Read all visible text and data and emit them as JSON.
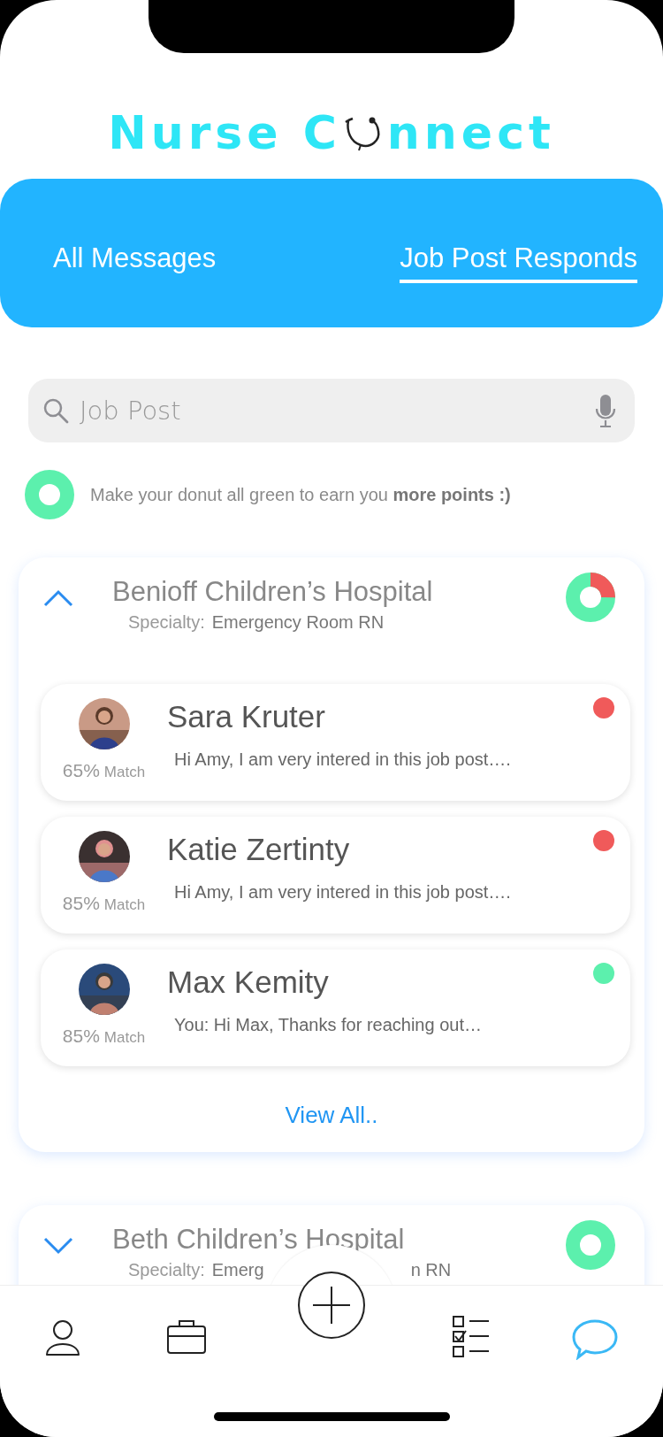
{
  "logo": {
    "text_start": "Nurse C",
    "text_end": "nnect"
  },
  "tabs": [
    {
      "label": "All Messages",
      "selected": false
    },
    {
      "label": "Job Post Responds",
      "selected": true
    }
  ],
  "search": {
    "placeholder": "Job Post"
  },
  "tip": {
    "donut_complete": true,
    "text": "Make your donut all green to earn you **more points :)**"
  },
  "jobs": [
    {
      "title": "Benioff Children’s Hospital",
      "specialty_label": "Specialty:",
      "specialty_parts": [
        "Emergency Room RN"
      ],
      "expanded": true,
      "donut_complete": false,
      "messages": [
        {
          "name": "Sara Kruter",
          "preview": "Hi Amy, I am very intered in this job post….",
          "match_percent": "65%",
          "match_label": "Match",
          "color": "#f05a5a"
        },
        {
          "name": "Katie Zertinty",
          "preview": "Hi Amy, I am very intered in this job post….",
          "match_percent": "85%",
          "match_label": "Match",
          "color": "#f05a5a"
        },
        {
          "name": "Max Kemity",
          "preview": "You: Hi Max, Thanks for reaching out…",
          "match_percent": "85%",
          "match_label": "Match",
          "color": "#5cf0ad"
        }
      ],
      "view_all": "View All.."
    },
    {
      "title": "Beth Children’s Hospital",
      "specialty_label": "Specialty:",
      "specialty_parts": [
        "Emerg",
        "n RN"
      ],
      "expanded": false,
      "donut_complete": true
    }
  ],
  "nav": [
    {
      "kind": "profile",
      "selected": false
    },
    {
      "kind": "briefcase",
      "selected": false
    },
    {
      "kind": "add",
      "selected": false
    },
    {
      "kind": "checklist",
      "selected": false
    },
    {
      "kind": "chat",
      "selected": true
    }
  ]
}
